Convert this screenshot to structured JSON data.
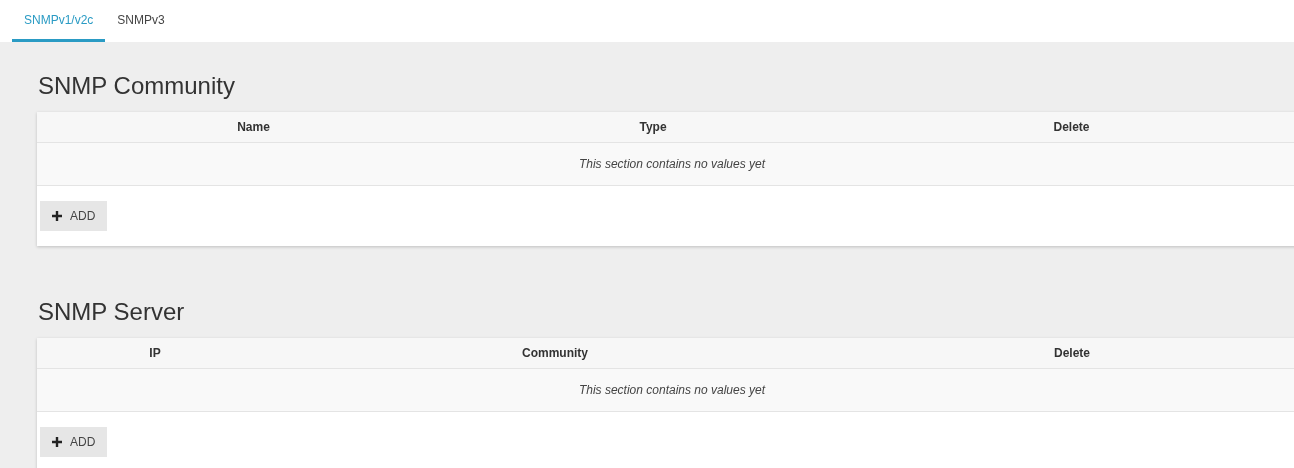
{
  "tabs": [
    {
      "label": "SNMPv1/v2c",
      "selected": true
    },
    {
      "label": "SNMPv3",
      "selected": false
    }
  ],
  "sections": [
    {
      "title": "SNMP Community",
      "columns": [
        "Name",
        "Type",
        "Delete"
      ],
      "empty_text": "This section contains no values yet",
      "add_button": "ADD"
    },
    {
      "title": "SNMP Server",
      "columns": [
        "IP",
        "Community",
        "Delete"
      ],
      "empty_text": "This section contains no values yet",
      "add_button": "ADD"
    }
  ]
}
